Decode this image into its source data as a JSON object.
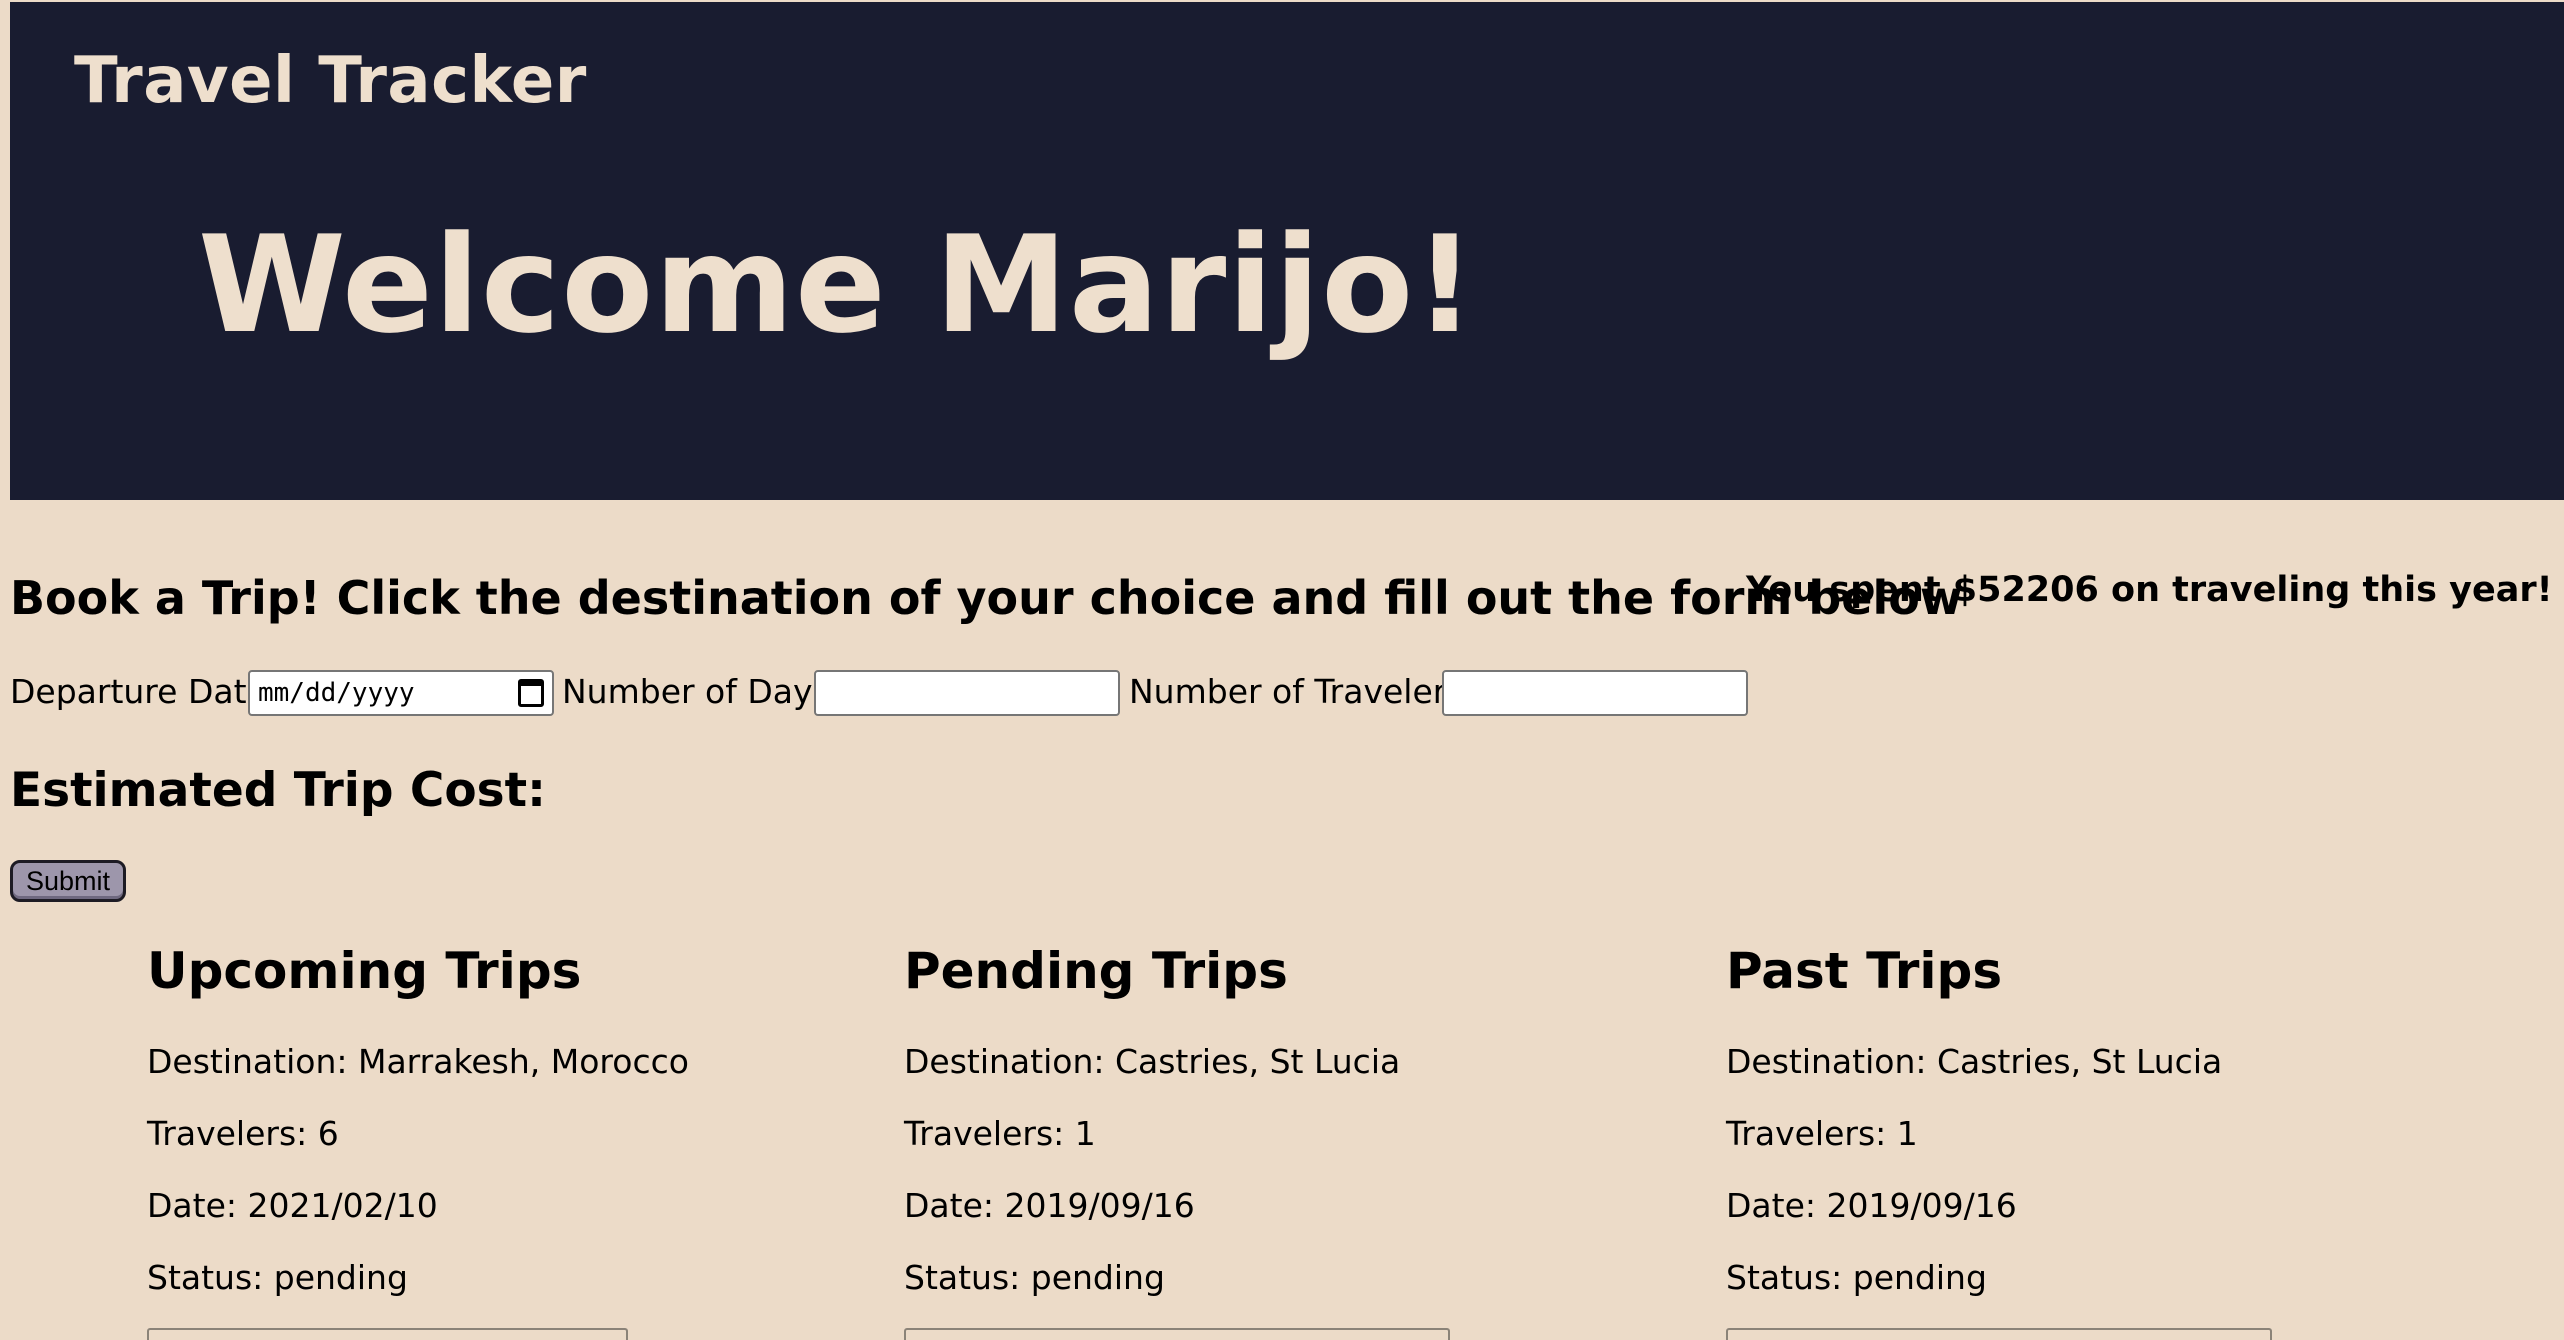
{
  "app": {
    "title": "Travel Tracker",
    "welcome": "Welcome Marijo!"
  },
  "booking": {
    "heading": "Book a Trip! Click the destination of your choice and fill out the form below",
    "spent_text": "You spent $52206 on traveling this year!",
    "departure_label": "Departure Date",
    "departure_placeholder": "mm/dd/yyyy",
    "days_label": "Number of Days",
    "days_value": "",
    "travelers_label": "Number of Travelers",
    "travelers_value": "",
    "estimate_label": "Estimated Trip Cost:",
    "submit_label": "Submit"
  },
  "trips": {
    "upcoming": {
      "title": "Upcoming Trips",
      "destination": "Destination: Marrakesh, Morocco",
      "travelers": "Travelers: 6",
      "date": "Date: 2021/02/10",
      "status": "Status: pending"
    },
    "pending": {
      "title": "Pending Trips",
      "destination": "Destination: Castries, St Lucia",
      "travelers": "Travelers: 1",
      "date": "Date: 2019/09/16",
      "status": "Status: pending"
    },
    "past": {
      "title": "Past Trips",
      "destination": "Destination: Castries, St Lucia",
      "travelers": "Travelers: 1",
      "date": "Date: 2019/09/16",
      "status": "Status: pending"
    }
  },
  "colors": {
    "header_bg": "#191c30",
    "header_text": "#eedfcd",
    "page_bg": "#ecdbc8",
    "button_bg": "#9d96ab"
  },
  "icons": {
    "date_picker": "calendar-icon"
  }
}
